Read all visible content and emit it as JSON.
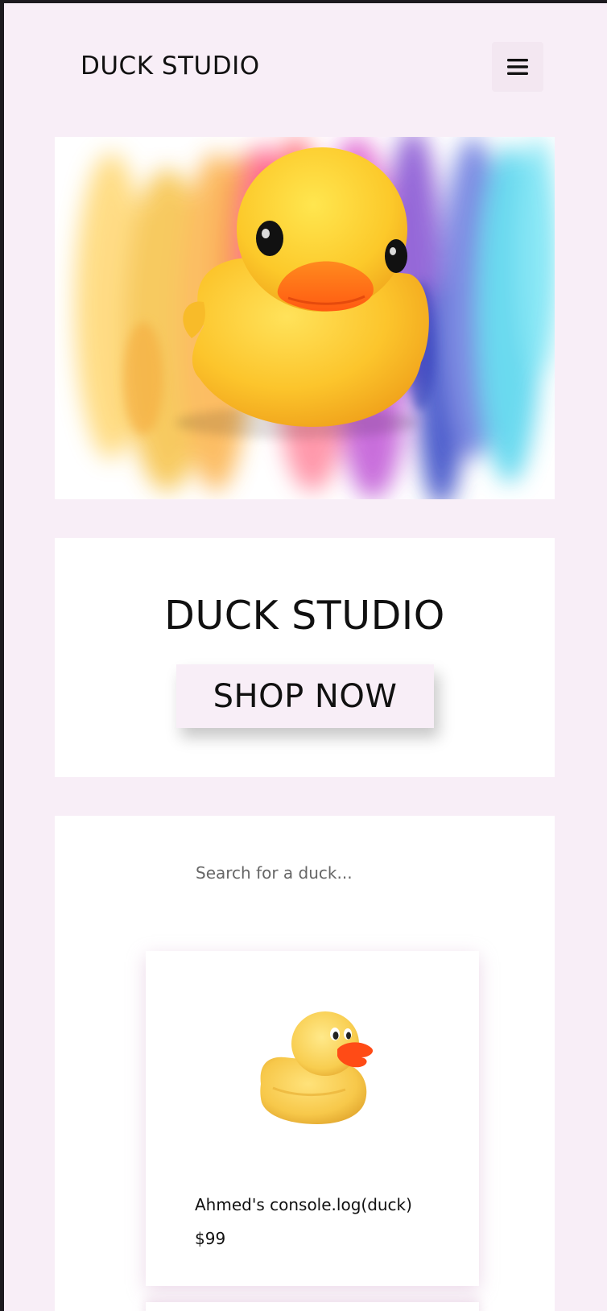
{
  "header": {
    "brand": "DUCK STUDIO",
    "menu_icon": "hamburger-menu-icon"
  },
  "hero": {
    "image": "rubber-duck-watercolor-splash"
  },
  "banner": {
    "title": "DUCK STUDIO",
    "cta_label": "SHOP NOW"
  },
  "search": {
    "placeholder": "Search for a duck...",
    "value": ""
  },
  "products": [
    {
      "name": "Ahmed's console.log(duck)",
      "price": "$99",
      "image": "rubber-duck"
    }
  ],
  "colors": {
    "page_background": "#f8eef7",
    "card_background": "#ffffff",
    "button_background": "#f8eef7",
    "text": "#111111",
    "duck_yellow": "#fbc02d",
    "duck_beak": "#ff6a13"
  }
}
